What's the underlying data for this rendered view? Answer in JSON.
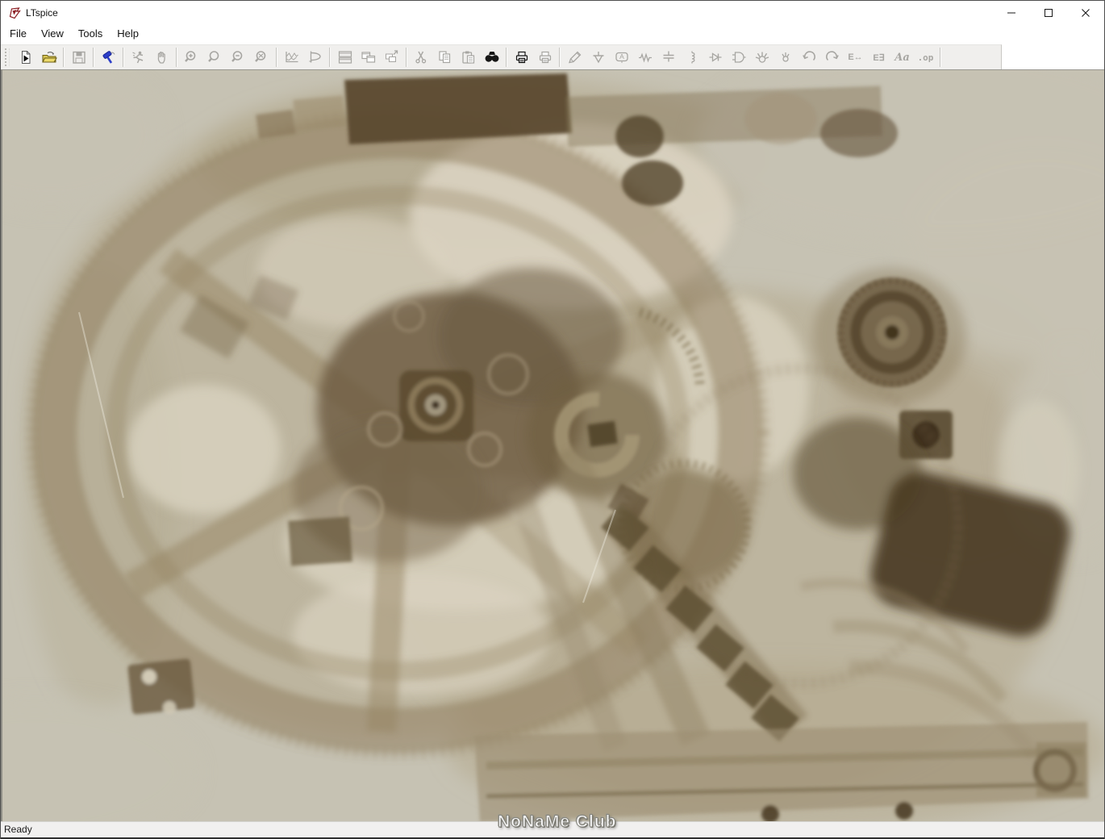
{
  "window": {
    "title": "LTspice"
  },
  "title_bar": {
    "buttons": [
      {
        "name": "minimize"
      },
      {
        "name": "maximize"
      },
      {
        "name": "close"
      }
    ]
  },
  "menu": {
    "items": [
      {
        "label": "File"
      },
      {
        "label": "View"
      },
      {
        "label": "Tools"
      },
      {
        "label": "Help"
      }
    ]
  },
  "toolbar": {
    "buttons": [
      {
        "name": "new-schematic",
        "icon": "new-schematic",
        "enabled": true
      },
      {
        "name": "open-file",
        "icon": "open-file",
        "enabled": true
      },
      {
        "type": "separator"
      },
      {
        "name": "save",
        "icon": "save",
        "enabled": false
      },
      {
        "type": "separator"
      },
      {
        "name": "control-panel",
        "icon": "control-panel",
        "enabled": true
      },
      {
        "type": "separator"
      },
      {
        "name": "run",
        "icon": "run",
        "enabled": false
      },
      {
        "name": "halt",
        "icon": "halt",
        "enabled": false
      },
      {
        "type": "separator"
      },
      {
        "name": "zoom-in",
        "icon": "zoom-in",
        "enabled": false
      },
      {
        "name": "zoom-full-extents",
        "icon": "zoom-full-extents",
        "enabled": false
      },
      {
        "name": "zoom-out",
        "icon": "zoom-out",
        "enabled": false
      },
      {
        "name": "zoom-back",
        "icon": "zoom-back",
        "enabled": false
      },
      {
        "type": "separator"
      },
      {
        "name": "autorange-y-axis",
        "icon": "autorange-y",
        "enabled": false
      },
      {
        "name": "plot-settings",
        "icon": "plot-settings",
        "enabled": false
      },
      {
        "type": "separator"
      },
      {
        "name": "tile-horizontally",
        "icon": "tile-horizontally",
        "enabled": false
      },
      {
        "name": "tile-vertically",
        "icon": "tile-vertically",
        "enabled": false
      },
      {
        "name": "cascade-windows",
        "icon": "cascade-windows",
        "enabled": false
      },
      {
        "type": "separator"
      },
      {
        "name": "cut",
        "icon": "cut",
        "enabled": false
      },
      {
        "name": "copy",
        "icon": "copy",
        "enabled": false
      },
      {
        "name": "paste",
        "icon": "paste",
        "enabled": false
      },
      {
        "name": "find",
        "icon": "find",
        "enabled": true
      },
      {
        "type": "separator"
      },
      {
        "name": "print",
        "icon": "print",
        "enabled": true
      },
      {
        "name": "print-preview",
        "icon": "print-preview",
        "enabled": false
      },
      {
        "type": "separator"
      },
      {
        "name": "wire",
        "icon": "wire",
        "enabled": false
      },
      {
        "name": "ground",
        "icon": "ground",
        "enabled": false
      },
      {
        "name": "label-net",
        "icon": "label-net",
        "enabled": false,
        "glyph": "A"
      },
      {
        "name": "resistor",
        "icon": "resistor",
        "enabled": false
      },
      {
        "name": "capacitor",
        "icon": "capacitor",
        "enabled": false
      },
      {
        "name": "inductor",
        "icon": "inductor",
        "enabled": false
      },
      {
        "name": "diode",
        "icon": "diode",
        "enabled": false
      },
      {
        "name": "component",
        "icon": "component",
        "enabled": false
      },
      {
        "name": "move",
        "icon": "move",
        "enabled": false
      },
      {
        "name": "drag",
        "icon": "drag",
        "enabled": false
      },
      {
        "name": "undo",
        "icon": "undo",
        "enabled": false
      },
      {
        "name": "redo",
        "icon": "redo",
        "enabled": false
      },
      {
        "name": "mirror",
        "icon": "glyph-mirror",
        "enabled": false,
        "glyph": "E↔"
      },
      {
        "name": "rotate",
        "icon": "glyph-rotate",
        "enabled": false,
        "glyph": "E∃"
      },
      {
        "name": "text",
        "icon": "glyph-text",
        "enabled": false,
        "glyph": "Aa"
      },
      {
        "name": "spice-directive",
        "icon": "glyph-op",
        "enabled": false,
        "glyph": ".op"
      },
      {
        "type": "separator"
      }
    ]
  },
  "canvas": {
    "subject": "xray-of-antikythera-mechanism-fragment",
    "colors": {
      "background": "#c6c2b3",
      "xray_light": "#dad3c1",
      "xray_mid": "#8f7d5c",
      "xray_dark": "#5b4a2e",
      "xray_darkest": "#46371f"
    }
  },
  "status_bar": {
    "text": "Ready"
  },
  "watermark": {
    "text": "NoNaMe Club"
  },
  "accent_colors": {
    "folder_yellow": "#d9c654",
    "hammer_blue": "#2d3fc9",
    "logo_red": "#8c1f24",
    "disabled_icon_gray": "#a7a6a2",
    "enabled_icon_black": "#161616"
  }
}
